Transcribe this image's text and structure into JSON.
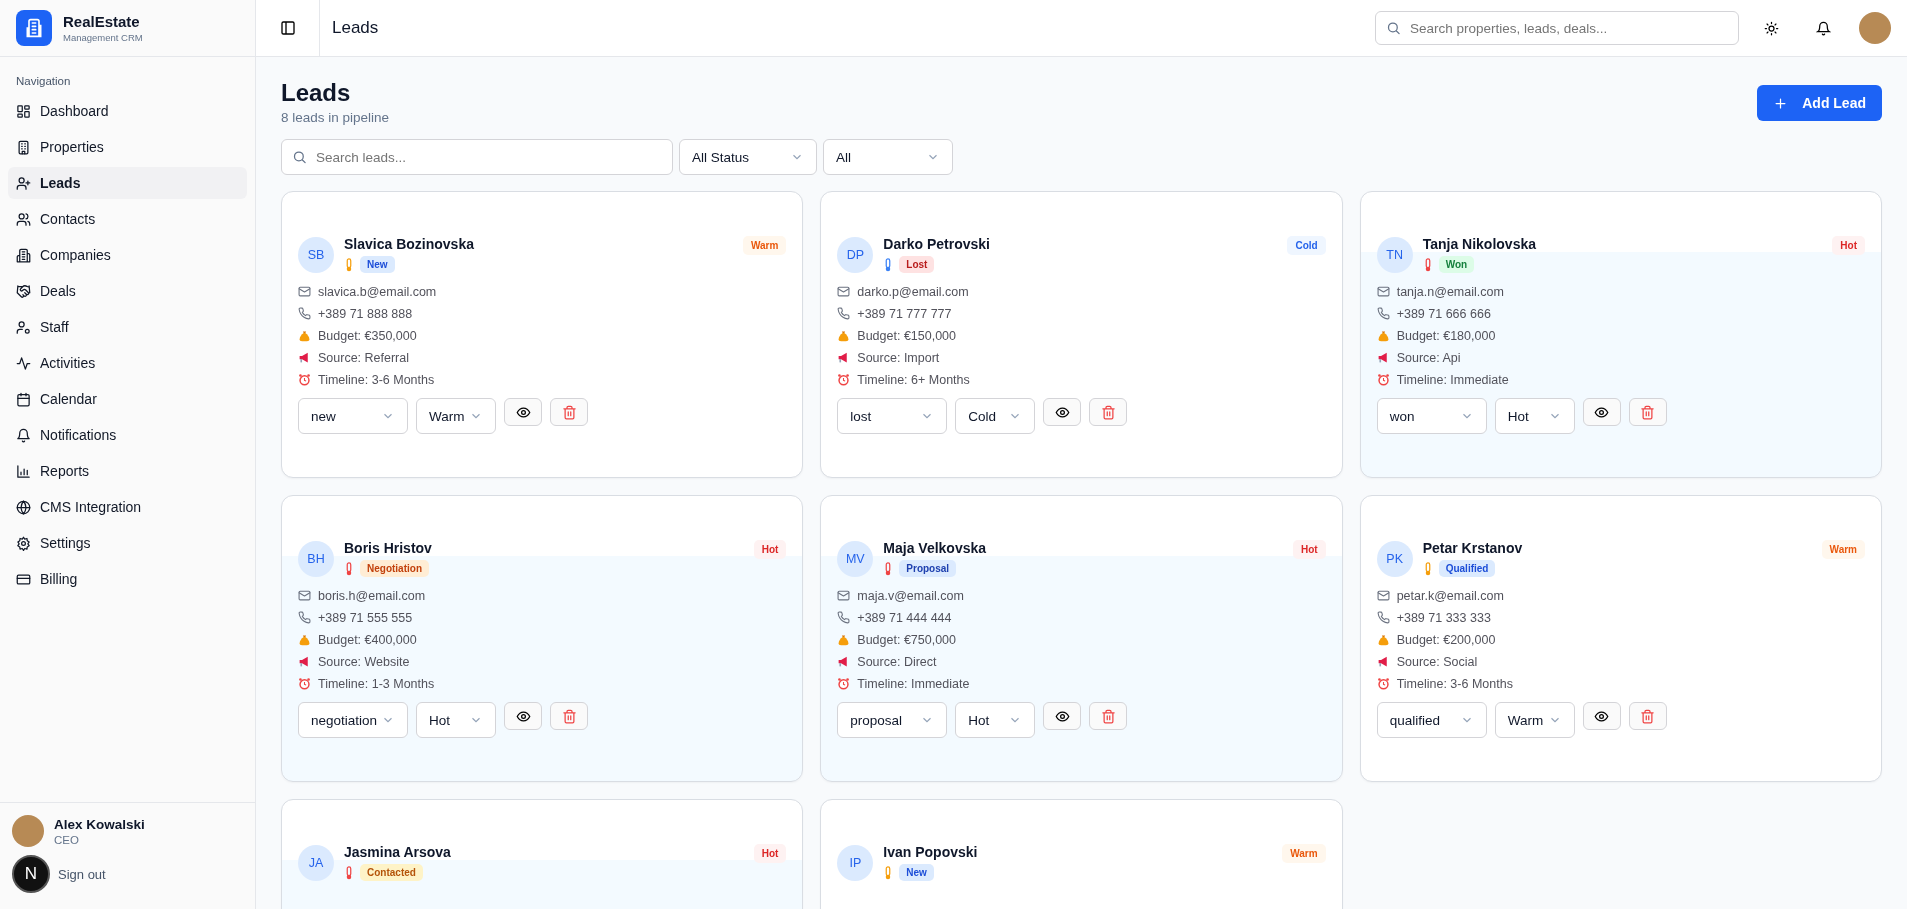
{
  "brand": {
    "name": "RealEstate",
    "subtitle": "Management CRM"
  },
  "sidebar": {
    "section": "Navigation",
    "items": [
      {
        "label": "Dashboard",
        "selected": false
      },
      {
        "label": "Properties",
        "selected": false
      },
      {
        "label": "Leads",
        "selected": true
      },
      {
        "label": "Contacts",
        "selected": false
      },
      {
        "label": "Companies",
        "selected": false
      },
      {
        "label": "Deals",
        "selected": false
      },
      {
        "label": "Staff",
        "selected": false
      },
      {
        "label": "Activities",
        "selected": false
      },
      {
        "label": "Calendar",
        "selected": false
      },
      {
        "label": "Notifications",
        "selected": false
      },
      {
        "label": "Reports",
        "selected": false
      },
      {
        "label": "CMS Integration",
        "selected": false
      },
      {
        "label": "Settings",
        "selected": false
      },
      {
        "label": "Billing",
        "selected": false
      }
    ],
    "user": {
      "name": "Alex Kowalski",
      "role": "CEO",
      "sign_out": "Sign out"
    },
    "dev_badge": "N"
  },
  "header": {
    "title": "Leads",
    "search_placeholder": "Search properties, leads, deals..."
  },
  "page": {
    "title": "Leads",
    "subtitle": "8 leads in pipeline",
    "add_button": "Add Lead",
    "search_placeholder": "Search leads...",
    "filters": [
      "All Status",
      "All"
    ]
  },
  "leads": [
    {
      "initials": "SB",
      "name": "Slavica Bozinovska",
      "status": {
        "label": "New",
        "kind": "new"
      },
      "temperature": {
        "label": "Warm",
        "kind": "warm"
      },
      "email": "slavica.b@email.com",
      "phone": "+389 71 888 888",
      "budget": "Budget: €350,000",
      "source": "Source:  Referral",
      "timeline": "Timeline:  3-6 Months",
      "status_select": "new",
      "temperature_select": "Warm"
    },
    {
      "initials": "DP",
      "name": "Darko Petrovski",
      "status": {
        "label": "Lost",
        "kind": "lost"
      },
      "temperature": {
        "label": "Cold",
        "kind": "cold"
      },
      "email": "darko.p@email.com",
      "phone": "+389 71 777 777",
      "budget": "Budget: €150,000",
      "source": "Source:  Import",
      "timeline": "Timeline:  6+ Months",
      "status_select": "lost",
      "temperature_select": "Cold"
    },
    {
      "initials": "TN",
      "name": "Tanja Nikolovska",
      "status": {
        "label": "Won",
        "kind": "won"
      },
      "temperature": {
        "label": "Hot",
        "kind": "hot"
      },
      "email": "tanja.n@email.com",
      "phone": "+389 71 666 666",
      "budget": "Budget: €180,000",
      "source": "Source:  Api",
      "timeline": "Timeline:  Immediate",
      "status_select": "won",
      "temperature_select": "Hot"
    },
    {
      "initials": "BH",
      "name": "Boris Hristov",
      "status": {
        "label": "Negotiation",
        "kind": "negotiation"
      },
      "temperature": {
        "label": "Hot",
        "kind": "hot"
      },
      "email": "boris.h@email.com",
      "phone": "+389 71 555 555",
      "budget": "Budget: €400,000",
      "source": "Source:  Website",
      "timeline": "Timeline:  1-3 Months",
      "status_select": "negotiation",
      "temperature_select": "Hot"
    },
    {
      "initials": "MV",
      "name": "Maja Velkovska",
      "status": {
        "label": "Proposal",
        "kind": "proposal"
      },
      "temperature": {
        "label": "Hot",
        "kind": "hot"
      },
      "email": "maja.v@email.com",
      "phone": "+389 71 444 444",
      "budget": "Budget: €750,000",
      "source": "Source:  Direct",
      "timeline": "Timeline:  Immediate",
      "status_select": "proposal",
      "temperature_select": "Hot"
    },
    {
      "initials": "PK",
      "name": "Petar Krstanov",
      "status": {
        "label": "Qualified",
        "kind": "qualified"
      },
      "temperature": {
        "label": "Warm",
        "kind": "warm"
      },
      "email": "petar.k@email.com",
      "phone": "+389 71 333 333",
      "budget": "Budget: €200,000",
      "source": "Source:  Social",
      "timeline": "Timeline:  3-6 Months",
      "status_select": "qualified",
      "temperature_select": "Warm"
    },
    {
      "initials": "JA",
      "name": "Jasmina Arsova",
      "status": {
        "label": "Contacted",
        "kind": "contacted"
      },
      "temperature": {
        "label": "Hot",
        "kind": "hot"
      }
    },
    {
      "initials": "IP",
      "name": "Ivan Popovski",
      "status": {
        "label": "New",
        "kind": "new"
      },
      "temperature": {
        "label": "Warm",
        "kind": "warm"
      }
    }
  ]
}
